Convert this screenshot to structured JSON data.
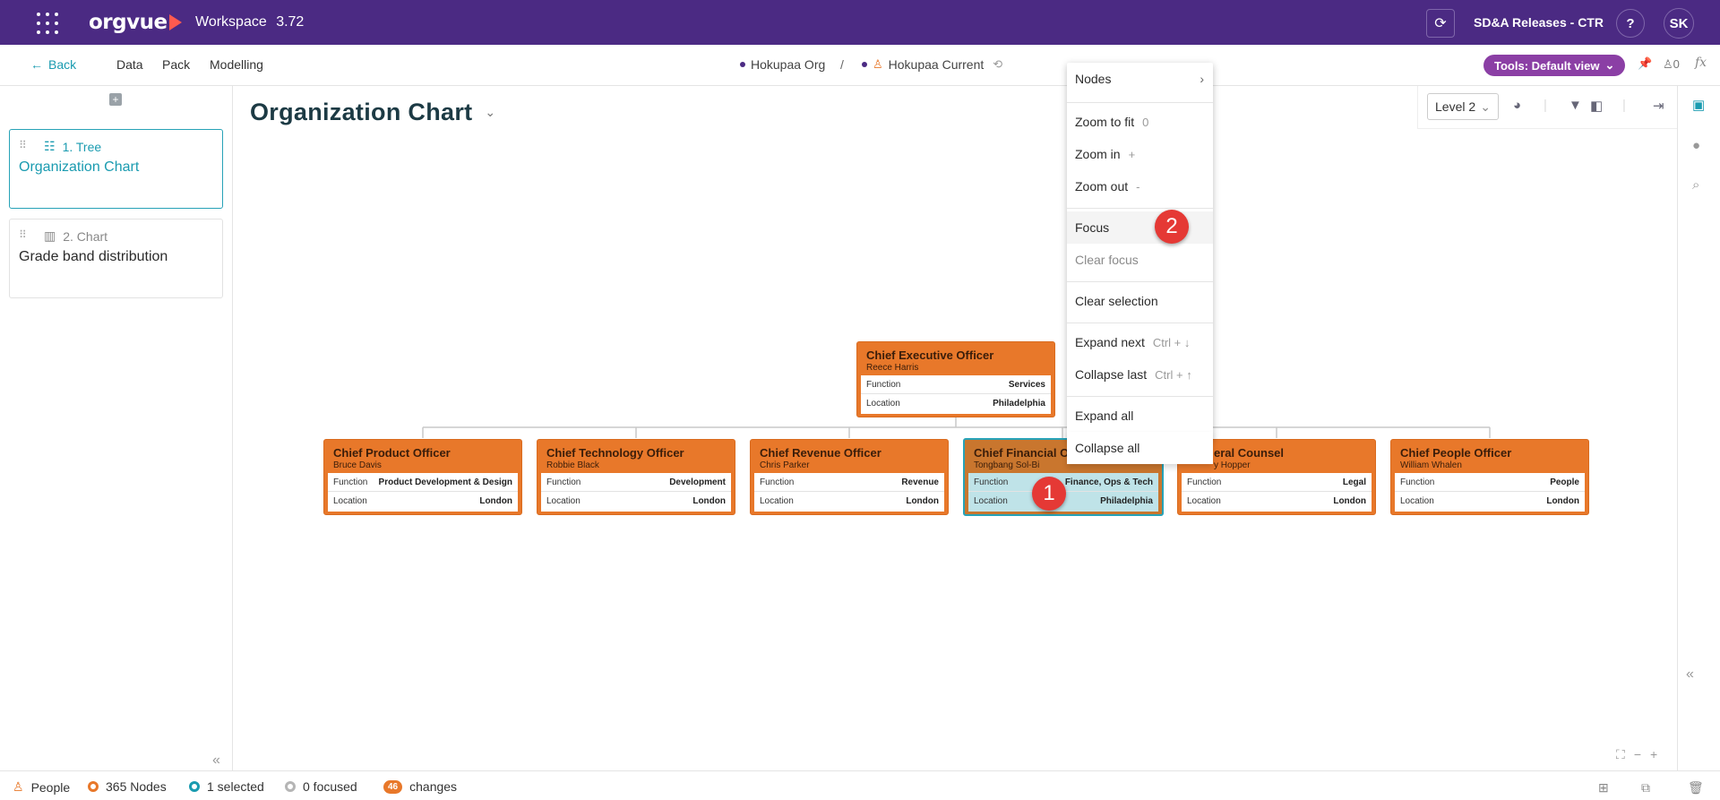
{
  "topbar": {
    "brand": "orgvue",
    "workspace_label": "Workspace",
    "version": "3.72",
    "release": "SD&A Releases - CTR",
    "help": "?",
    "user_initials": "SK"
  },
  "nav": {
    "back": "Back",
    "items": [
      "Data",
      "Pack",
      "Modelling"
    ],
    "crumb_org": "Hokupaa Org",
    "crumb_sep": "/",
    "crumb_dataset": "Hokupaa Current",
    "tools": "Tools: Default view",
    "users_count": "0",
    "fx": "fx"
  },
  "pages": [
    {
      "type": "1. Tree",
      "name": "Organization Chart",
      "active": true
    },
    {
      "type": "2. Chart",
      "name": "Grade band distribution",
      "active": false
    }
  ],
  "chart": {
    "title": "Organization Chart",
    "level": "Level 2"
  },
  "org": {
    "ceo": {
      "title": "Chief Executive Officer",
      "name": "Reece Harris",
      "function": "Services",
      "location": "Philadelphia"
    },
    "field_labels": {
      "function": "Function",
      "location": "Location"
    },
    "reports": [
      {
        "title": "Chief Product Officer",
        "name": "Bruce Davis",
        "function": "Product Development & Design",
        "location": "London"
      },
      {
        "title": "Chief Technology Officer",
        "name": "Robbie Black",
        "function": "Development",
        "location": "London"
      },
      {
        "title": "Chief Revenue Officer",
        "name": "Chris Parker",
        "function": "Revenue",
        "location": "London"
      },
      {
        "title": "Chief Financial O",
        "name": "Tongbang Sol-Bi",
        "function": "Finance, Ops & Tech",
        "location": "Philadelphia"
      },
      {
        "title": "eral Counsel",
        "name": "y Hopper",
        "function": "Legal",
        "location": "London"
      },
      {
        "title": "Chief People Officer",
        "name": "William Whalen",
        "function": "People",
        "location": "London"
      }
    ]
  },
  "menu": {
    "nodes": "Nodes",
    "zoom_fit": "Zoom to fit",
    "zoom_fit_key": "0",
    "zoom_in": "Zoom in",
    "zoom_in_key": "+",
    "zoom_out": "Zoom out",
    "zoom_out_key": "-",
    "focus": "Focus",
    "clear_focus": "Clear focus",
    "clear_selection": "Clear selection",
    "expand_next": "Expand next",
    "expand_next_key": "Ctrl + ↓",
    "collapse_last": "Collapse last",
    "collapse_last_key": "Ctrl + ↑",
    "expand_all": "Expand all",
    "collapse_all": "Collapse all"
  },
  "markers": {
    "one": "1",
    "two": "2"
  },
  "status": {
    "people": "People",
    "nodes": "365 Nodes",
    "selected": "1 selected",
    "focused": "0 focused",
    "changes_count": "46",
    "changes": "changes"
  },
  "colors": {
    "brand_purple": "#4b2a83",
    "tools_purple": "#8b3fa5",
    "node_orange": "#e8782a",
    "accent_teal": "#1a9bb0",
    "marker_red": "#e53935"
  }
}
